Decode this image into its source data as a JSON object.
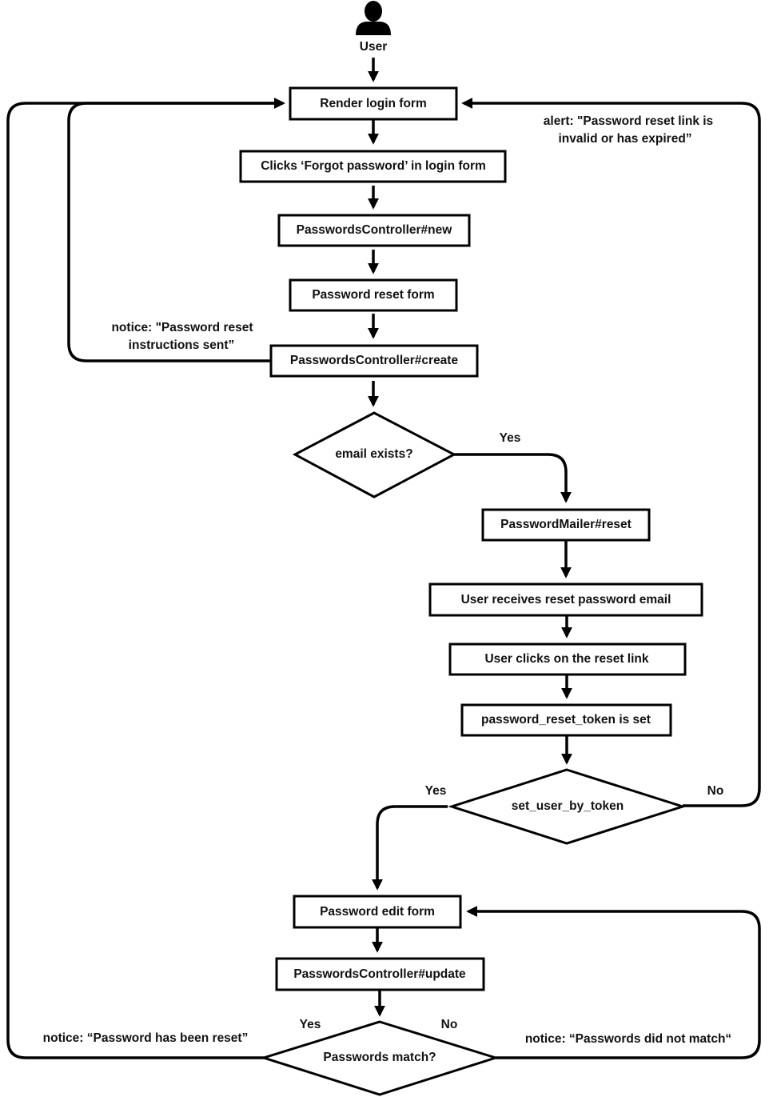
{
  "diagram": {
    "type": "flowchart",
    "actor": {
      "label": "User",
      "icon": "user-icon"
    },
    "nodes": {
      "render_login": "Render login form",
      "clicks_forgot": "Clicks ‘Forgot password’ in login form",
      "pc_new": "PasswordsController#new",
      "reset_form": "Password reset form",
      "pc_create": "PasswordsController#create",
      "email_exists": "email exists?",
      "mailer_reset": "PasswordMailer#reset",
      "receives_email": "User receives reset password email",
      "clicks_link": "User clicks on the reset link",
      "token_set": "password_reset_token is set",
      "set_user_by_token": "set_user_by_token",
      "edit_form": "Password edit form",
      "pc_update": "PasswordsController#update",
      "passwords_match": "Passwords match?"
    },
    "edge_labels": {
      "email_yes": "Yes",
      "token_yes": "Yes",
      "token_no": "No",
      "match_yes": "Yes",
      "match_no": "No"
    },
    "annotations": {
      "alert_line1": "alert: \"Password reset link is",
      "alert_line2": "invalid or has expired”",
      "notice_sent_line1": "notice: \"Password reset",
      "notice_sent_line2": "instructions sent”",
      "notice_reset": "notice: “Password has been reset”",
      "notice_mismatch": "notice: “Passwords did not match“"
    },
    "edges": [
      [
        "actor",
        "render_login"
      ],
      [
        "render_login",
        "clicks_forgot"
      ],
      [
        "clicks_forgot",
        "pc_new"
      ],
      [
        "pc_new",
        "reset_form"
      ],
      [
        "reset_form",
        "pc_create"
      ],
      [
        "pc_create",
        "render_login",
        "notice_sent"
      ],
      [
        "pc_create",
        "email_exists"
      ],
      [
        "email_exists",
        "mailer_reset",
        "Yes"
      ],
      [
        "mailer_reset",
        "receives_email"
      ],
      [
        "receives_email",
        "clicks_link"
      ],
      [
        "clicks_link",
        "token_set"
      ],
      [
        "token_set",
        "set_user_by_token"
      ],
      [
        "set_user_by_token",
        "edit_form",
        "Yes"
      ],
      [
        "set_user_by_token",
        "render_login",
        "No"
      ],
      [
        "edit_form",
        "pc_update"
      ],
      [
        "pc_update",
        "passwords_match"
      ],
      [
        "passwords_match",
        "render_login",
        "Yes"
      ],
      [
        "passwords_match",
        "edit_form",
        "No"
      ]
    ]
  }
}
